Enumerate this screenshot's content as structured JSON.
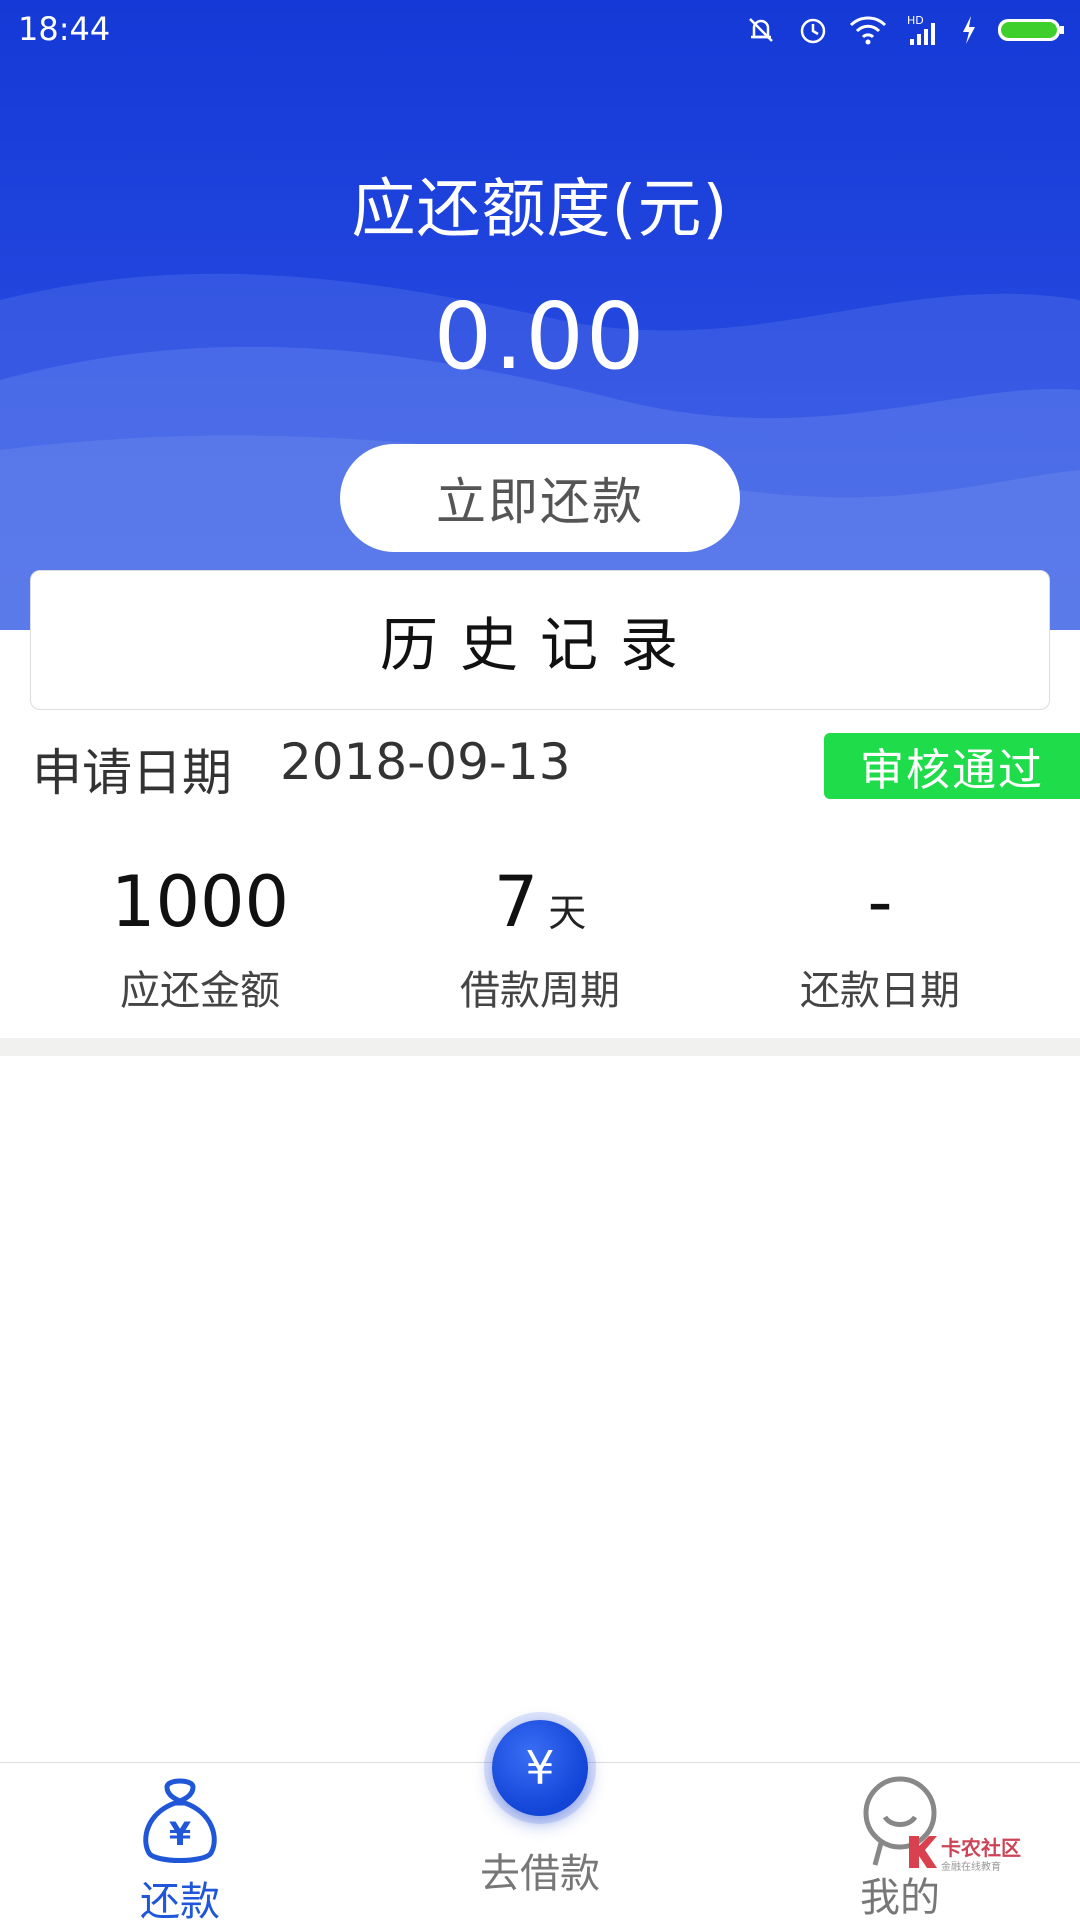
{
  "status_bar": {
    "time": "18:44",
    "icons": [
      "bell-muted-icon",
      "alarm-icon",
      "wifi-icon",
      "signal-hd-icon",
      "charging-icon",
      "battery-icon"
    ],
    "signal_badge": "HD"
  },
  "header": {
    "title": "应还额度(元)",
    "amount": "0.00",
    "repay_button": "立即还款"
  },
  "history": {
    "title": "历史记录"
  },
  "record": {
    "date_label": "申请日期",
    "date_value": "2018-09-13",
    "status": "审核通过",
    "stats": [
      {
        "value": "1000",
        "unit": "",
        "label": "应还金额"
      },
      {
        "value": "7",
        "unit": "天",
        "label": "借款周期"
      },
      {
        "value": "-",
        "unit": "",
        "label": "还款日期"
      }
    ]
  },
  "tabbar": {
    "tabs": [
      {
        "label": "还款",
        "icon": "money-bag-icon",
        "active": true
      },
      {
        "label": "去借款",
        "icon": "yuan-circle-icon",
        "active": false
      },
      {
        "label": "我的",
        "icon": "user-face-icon",
        "active": false
      }
    ],
    "center_symbol": "¥",
    "bag_symbol": "¥"
  },
  "watermark": {
    "text": "卡农社区",
    "subtext": "金融在线教育"
  },
  "colors": {
    "header_blue": "#1439d6",
    "active_tab": "#1f57d8",
    "status_green": "#1fdc4a",
    "inactive_tab": "#777777"
  }
}
